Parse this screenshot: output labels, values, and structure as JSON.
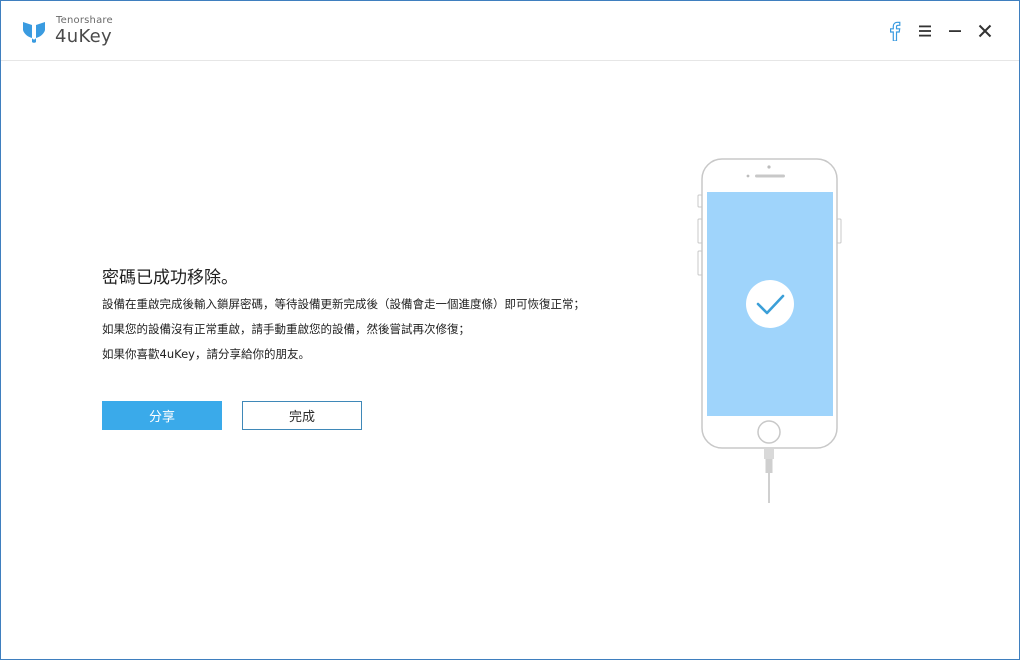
{
  "app": {
    "brand_small": "Tenorshare",
    "brand_name": "4uKey"
  },
  "titlebar": {
    "icons": [
      "facebook-icon",
      "menu-icon",
      "minimize-icon",
      "close-icon"
    ]
  },
  "message": {
    "title": "密碼已成功移除。",
    "lines": [
      "設備在重啟完成後輸入鎖屏密碼，等待設備更新完成後（設備會走一個進度條）即可恢復正常；",
      "如果您的設備沒有正常重啟，請手動重啟您的設備，然後嘗試再次修復；",
      "如果你喜歡4uKey，請分享給你的朋友。"
    ]
  },
  "buttons": {
    "share": "分享",
    "done": "完成"
  },
  "colors": {
    "accent": "#3aaaea",
    "screen": "#9fd4fb",
    "logo": "#3a9be0",
    "facebook": "#3a9be0"
  }
}
